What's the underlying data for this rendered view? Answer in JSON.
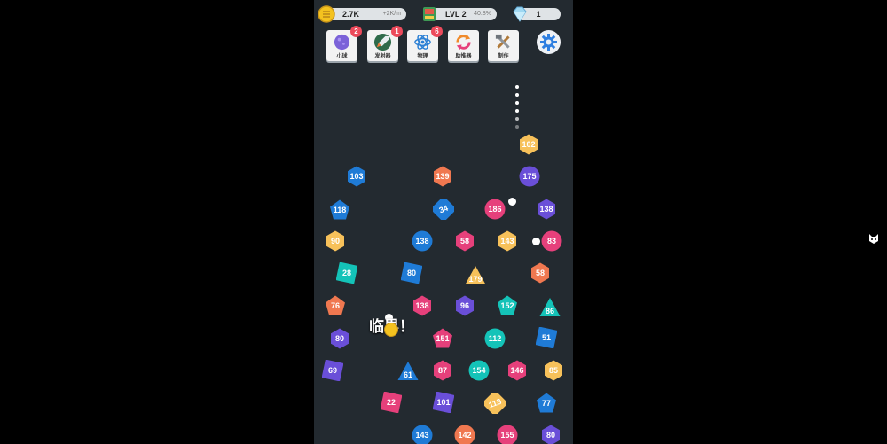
{
  "hud": {
    "coins": {
      "value": "2.7K",
      "rate": "+2K/m",
      "icon": "coin-stack-icon"
    },
    "level": {
      "label": "LVL 2",
      "progress": "40.8%",
      "icon": "level-book-icon"
    },
    "gems": {
      "value": "1",
      "icon": "gem-icon"
    }
  },
  "toolbar": [
    {
      "label": "小球",
      "badge": "2",
      "icon": "ball-icon"
    },
    {
      "label": "发射器",
      "badge": "1",
      "icon": "rocket-icon"
    },
    {
      "label": "物理",
      "badge": "6",
      "icon": "atom-icon"
    },
    {
      "label": "助推器",
      "badge": "",
      "icon": "booster-icon"
    },
    {
      "label": "制作",
      "badge": "",
      "icon": "tools-icon"
    }
  ],
  "settings_icon": "gear-icon",
  "critical_text": "临界！",
  "colors": {
    "yellow": "#f7c15a",
    "orange": "#f07850",
    "purple": "#6a4fd8",
    "blue": "#1f7bd6",
    "pink": "#e6407b",
    "teal": "#14c3b8",
    "background": "#232a30"
  },
  "blocks": [
    {
      "v": "102",
      "c": "yellow",
      "s": "hex"
    },
    {
      "v": "103",
      "c": "blue",
      "s": "hex"
    },
    {
      "v": "139",
      "c": "orange",
      "s": "hex"
    },
    {
      "v": "175",
      "c": "purple",
      "s": "circle"
    },
    {
      "v": "118",
      "c": "blue",
      "s": "pent"
    },
    {
      "v": "34",
      "c": "blue",
      "s": "diamond"
    },
    {
      "v": "186",
      "c": "pink",
      "s": "circle"
    },
    {
      "v": "138",
      "c": "purple",
      "s": "hex"
    },
    {
      "v": "90",
      "c": "yellow",
      "s": "hex"
    },
    {
      "v": "138",
      "c": "blue",
      "s": "circle"
    },
    {
      "v": "58",
      "c": "pink",
      "s": "hex"
    },
    {
      "v": "143",
      "c": "yellow",
      "s": "hex"
    },
    {
      "v": "83",
      "c": "pink",
      "s": "circle"
    },
    {
      "v": "28",
      "c": "teal",
      "s": "square"
    },
    {
      "v": "80",
      "c": "blue",
      "s": "square"
    },
    {
      "v": "179",
      "c": "yellow",
      "s": "tri"
    },
    {
      "v": "58",
      "c": "orange",
      "s": "hex"
    },
    {
      "v": "76",
      "c": "orange",
      "s": "pent"
    },
    {
      "v": "138",
      "c": "pink",
      "s": "hex"
    },
    {
      "v": "96",
      "c": "purple",
      "s": "hex"
    },
    {
      "v": "152",
      "c": "teal",
      "s": "pent"
    },
    {
      "v": "86",
      "c": "teal",
      "s": "tri"
    },
    {
      "v": "80",
      "c": "purple",
      "s": "hex"
    },
    {
      "v": "151",
      "c": "pink",
      "s": "pent"
    },
    {
      "v": "112",
      "c": "teal",
      "s": "circle"
    },
    {
      "v": "51",
      "c": "blue",
      "s": "square"
    },
    {
      "v": "69",
      "c": "purple",
      "s": "square"
    },
    {
      "v": "61",
      "c": "blue",
      "s": "tri"
    },
    {
      "v": "87",
      "c": "pink",
      "s": "hex"
    },
    {
      "v": "154",
      "c": "teal",
      "s": "circle"
    },
    {
      "v": "146",
      "c": "pink",
      "s": "hex"
    },
    {
      "v": "85",
      "c": "yellow",
      "s": "hex"
    },
    {
      "v": "22",
      "c": "pink",
      "s": "square"
    },
    {
      "v": "101",
      "c": "purple",
      "s": "square"
    },
    {
      "v": "118",
      "c": "yellow",
      "s": "diamond"
    },
    {
      "v": "77",
      "c": "blue",
      "s": "pent"
    },
    {
      "v": "143",
      "c": "blue",
      "s": "circle"
    },
    {
      "v": "142",
      "c": "orange",
      "s": "circle"
    },
    {
      "v": "155",
      "c": "pink",
      "s": "circle"
    },
    {
      "v": "80",
      "c": "purple",
      "s": "hex"
    }
  ],
  "side_icon": "cat-face-icon"
}
